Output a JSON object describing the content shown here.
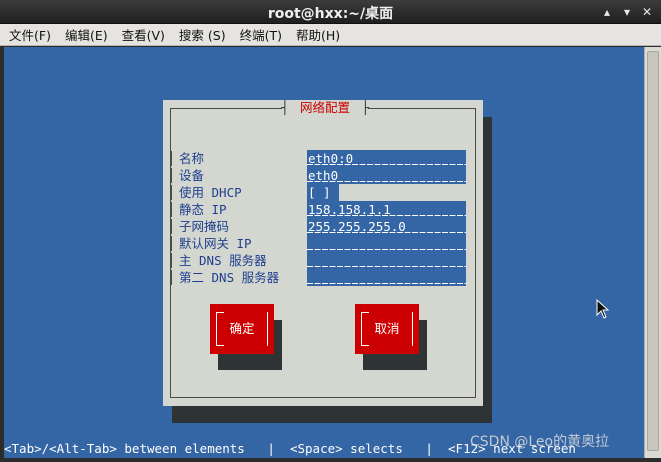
{
  "window": {
    "title": "root@hxx:~/桌面",
    "controls": {
      "minimize": "▴",
      "maximize": "▾",
      "close": "✕"
    }
  },
  "menubar": {
    "items": [
      "文件(F)",
      "编辑(E)",
      "查看(V)",
      "搜索 (S)",
      "终端(T)",
      "帮助(H)"
    ]
  },
  "dialog": {
    "title": "网络配置",
    "fields": [
      {
        "label": "名称",
        "value": "eth0:0"
      },
      {
        "label": "设备",
        "value": "eth0"
      },
      {
        "label": "使用 DHCP",
        "value": "[ ]"
      },
      {
        "label": "静态 IP",
        "value": "158.158.1.1"
      },
      {
        "label": "子网掩码",
        "value": "255.255.255.0"
      },
      {
        "label": "默认网关 IP",
        "value": ""
      },
      {
        "label": "主 DNS 服务器",
        "value": ""
      },
      {
        "label": "第二 DNS 服务器",
        "value": ""
      }
    ],
    "ok_label": "确定",
    "cancel_label": "取消"
  },
  "statusline": "<Tab>/<Alt-Tab> between elements   |  <Space> selects   |  <F12> next screen",
  "watermark": "CSDN @Leo的黄奥拉",
  "colors": {
    "terminal_bg": "#3465a4",
    "dialog_bg": "#d3d7cf",
    "button_bg": "#cc0000",
    "title_text": "#cc0000",
    "label_text": "#1f3f8f"
  }
}
